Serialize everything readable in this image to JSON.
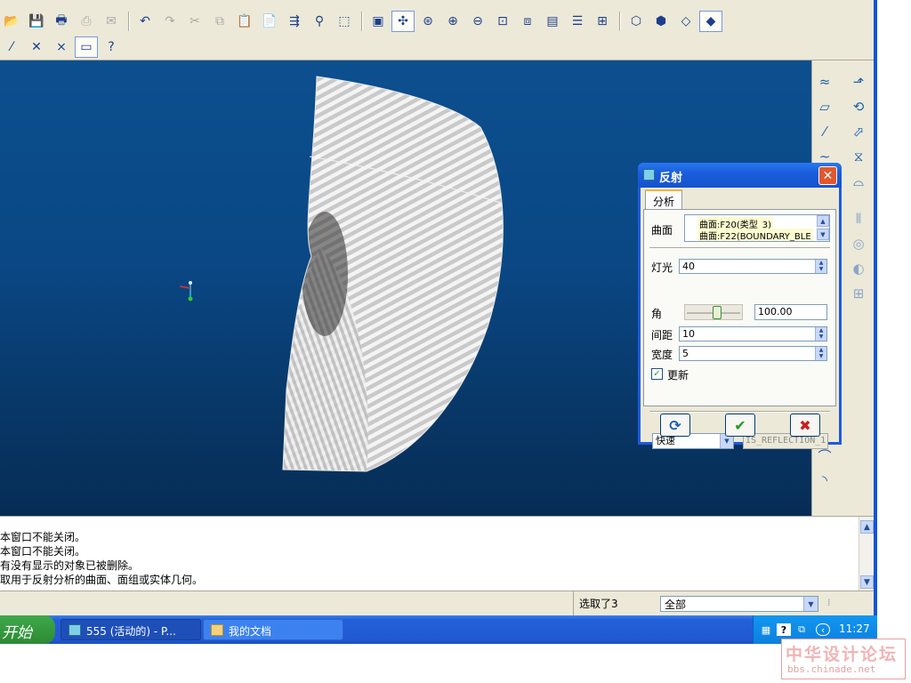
{
  "toolbar": {
    "row1_icons": [
      "open-folder-icon",
      "save-icon",
      "print-icon",
      "print-quick-icon",
      "email-icon",
      "undo-icon",
      "redo-icon",
      "cut-icon",
      "copy-icon",
      "paste-icon",
      "paste-special-icon",
      "regenerate-icon",
      "find-icon",
      "select-box-icon",
      "repaint-icon",
      "spin-center-icon",
      "orient-icon",
      "zoom-in-icon",
      "zoom-out-icon",
      "refit-icon",
      "view-manager-icon",
      "saved-views-icon",
      "layers-icon",
      "model-tree-icon",
      "wireframe-icon",
      "hidden-line-icon",
      "no-hidden-icon",
      "shading-icon"
    ],
    "row2_icons": [
      "datum-axis-icon",
      "datum-point-icon",
      "coordinate-system-icon",
      "annotation-icon",
      "context-help-icon"
    ]
  },
  "dialog": {
    "title": "反射",
    "tab": "分析",
    "surface_label": "曲面",
    "surfaces": [
      "曲面:F20(类型_3)",
      "曲面:F22(BOUNDARY_BLE"
    ],
    "light_label": "灯光",
    "light_value": "40",
    "angle_label": "角",
    "angle_value": "100.00",
    "spacing_label": "间距",
    "spacing_value": "10",
    "width_label": "宽度",
    "width_value": "5",
    "update_label": "更新",
    "update_checked": true,
    "mode_value": "快速",
    "analysis_name": "IS_REFLECTION_1",
    "close_symbol": "✕",
    "ok_symbol": "✔",
    "cancel_symbol": "✖",
    "repeat_symbol": "⟳"
  },
  "messages": [
    "本窗口不能关闭。",
    "本窗口不能关闭。",
    "有没有显示的对象已被删除。",
    "取用于反射分析的曲面、面组或实体几何。"
  ],
  "status": {
    "selected": "选取了3",
    "filter": "全部"
  },
  "taskbar": {
    "start": "开始",
    "tasks": [
      "555 (活动的) - P...",
      "我的文档"
    ],
    "clock": "11:27"
  },
  "watermark": {
    "text": "中华设计论坛",
    "url": "bbs.chinade.net"
  },
  "colors": {
    "viewport_top": "#0c4f8f",
    "viewport_bottom": "#062c55",
    "dialog_title": "#1a5edb",
    "ok_green": "#1f9a1f",
    "cancel_red": "#c81e1e"
  }
}
